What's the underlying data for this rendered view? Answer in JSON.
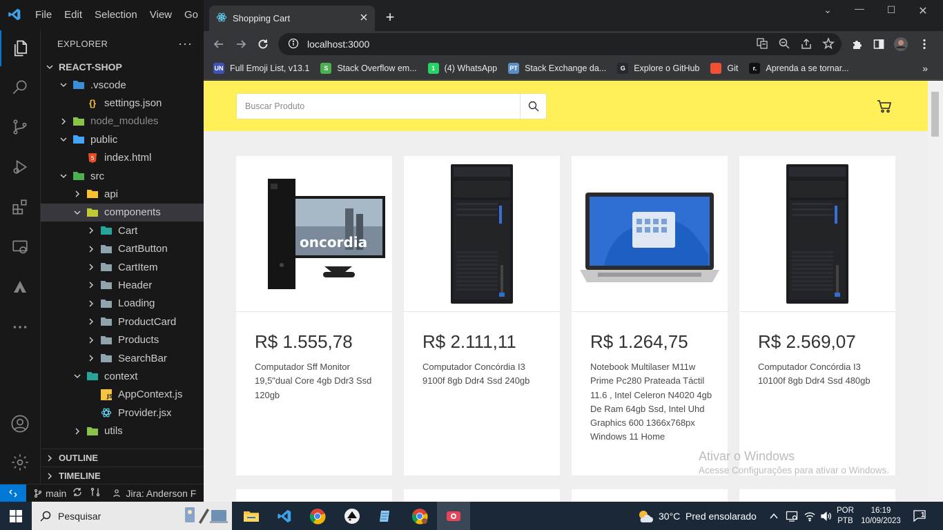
{
  "vscode": {
    "menu": [
      "File",
      "Edit",
      "Selection",
      "View",
      "Go"
    ],
    "explorer_title": "EXPLORER",
    "root_folder": "REACT-SHOP",
    "tree": [
      {
        "label": ".vscode",
        "depth": 1,
        "chev": "down",
        "kind": "folder-vscode"
      },
      {
        "label": "settings.json",
        "depth": 2,
        "chev": "",
        "kind": "json"
      },
      {
        "label": "node_modules",
        "depth": 1,
        "chev": "right",
        "kind": "folder-node",
        "dim": true
      },
      {
        "label": "public",
        "depth": 1,
        "chev": "down",
        "kind": "folder-public"
      },
      {
        "label": "index.html",
        "depth": 2,
        "chev": "",
        "kind": "html"
      },
      {
        "label": "src",
        "depth": 1,
        "chev": "down",
        "kind": "folder-src"
      },
      {
        "label": "api",
        "depth": 2,
        "chev": "right",
        "kind": "folder-api"
      },
      {
        "label": "components",
        "depth": 2,
        "chev": "down",
        "kind": "folder-components",
        "selected": true
      },
      {
        "label": "Cart",
        "depth": 3,
        "chev": "right",
        "kind": "folder-cart"
      },
      {
        "label": "CartButton",
        "depth": 3,
        "chev": "right",
        "kind": "folder"
      },
      {
        "label": "CartItem",
        "depth": 3,
        "chev": "right",
        "kind": "folder"
      },
      {
        "label": "Header",
        "depth": 3,
        "chev": "right",
        "kind": "folder"
      },
      {
        "label": "Loading",
        "depth": 3,
        "chev": "right",
        "kind": "folder"
      },
      {
        "label": "ProductCard",
        "depth": 3,
        "chev": "right",
        "kind": "folder"
      },
      {
        "label": "Products",
        "depth": 3,
        "chev": "right",
        "kind": "folder"
      },
      {
        "label": "SearchBar",
        "depth": 3,
        "chev": "right",
        "kind": "folder"
      },
      {
        "label": "context",
        "depth": 2,
        "chev": "down",
        "kind": "folder-context"
      },
      {
        "label": "AppContext.js",
        "depth": 3,
        "chev": "",
        "kind": "js"
      },
      {
        "label": "Provider.jsx",
        "depth": 3,
        "chev": "",
        "kind": "jsx"
      },
      {
        "label": "utils",
        "depth": 2,
        "chev": "right",
        "kind": "folder-utils"
      }
    ],
    "outline": "OUTLINE",
    "timeline": "TIMELINE",
    "status": {
      "branch": "main",
      "jira": "Jira: Anderson F"
    }
  },
  "browser": {
    "tab_title": "Shopping Cart",
    "url": "localhost:3000",
    "bookmarks": [
      {
        "label": "Full Emoji List, v13.1",
        "icon": "UN",
        "color": "#3f51b5"
      },
      {
        "label": "Stack Overflow em...",
        "icon": "S",
        "color": "#4caf50"
      },
      {
        "label": "(4) WhatsApp",
        "icon": "1",
        "color": "#25d366"
      },
      {
        "label": "Stack Exchange da...",
        "icon": "PT",
        "color": "#5c8ec6"
      },
      {
        "label": "Explore o GitHub",
        "icon": "G",
        "color": "#24292e"
      },
      {
        "label": "Git",
        "icon": "",
        "color": "#f05133"
      },
      {
        "label": "Aprenda a se tornar...",
        "icon": "r.",
        "color": "#111111"
      }
    ]
  },
  "page": {
    "search_placeholder": "Buscar Produto",
    "products": [
      {
        "price": "R$ 1.555,78",
        "title": "Computador Sff Monitor 19,5\"dual Core 4gb Ddr3 Ssd 120gb",
        "image": "desktop-with-monitor"
      },
      {
        "price": "R$ 2.111,11",
        "title": "Computador Concórdia I3 9100f 8gb Ddr4 Ssd 240gb",
        "image": "tower-pc"
      },
      {
        "price": "R$ 1.264,75",
        "title": "Notebook Multilaser M11w Prime Pc280 Prateada Táctil 11.6 , Intel Celeron N4020 4gb De Ram 64gb Ssd, Intel Uhd Graphics 600 1366x768px Windows 11 Home",
        "image": "laptop"
      },
      {
        "price": "R$ 2.569,07",
        "title": "Computador Concórdia I3 10100f 8gb Ddr4 Ssd 480gb",
        "image": "tower-pc"
      }
    ],
    "watermark_title": "Ativar o Windows",
    "watermark_sub": "Acesse Configurações para ativar o Windows."
  },
  "taskbar": {
    "search_label": "Pesquisar",
    "weather": "30°C  Pred ensolarado",
    "lang1": "POR",
    "lang2": "PTB",
    "time": "16:19",
    "date": "10/09/2023",
    "notification_count": "1"
  },
  "colors": {
    "accent": "#0078d4",
    "header_yellow": "#fff059"
  }
}
